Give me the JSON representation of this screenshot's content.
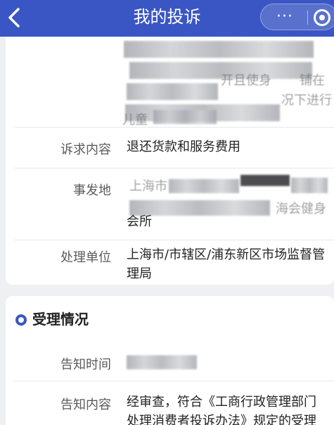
{
  "nav": {
    "title": "我的投诉",
    "more_icon": "···"
  },
  "details": {
    "partial_lines": [
      "开且使身",
      "铺在",
      "况下进行",
      "儿童"
    ],
    "appeal_label": "诉求内容",
    "appeal_value": "退还货款和服务费用",
    "location_label": "事发地",
    "location_value_line1": "上海市",
    "location_value_line2": "海会健身",
    "location_value_line3": "会所",
    "unit_label": "处理单位",
    "unit_value_line1": "上海市/市辖区/浦东新区市场监督管",
    "unit_value_line2": "理局"
  },
  "acceptance": {
    "section_title": "受理情况",
    "notice_time_label": "告知时间",
    "notice_content_label": "告知内容",
    "notice_content_line1": "经审查，符合《工商行政管理部门",
    "notice_content_line2": "处理消费者投诉办法》规定的受理"
  },
  "colors": {
    "primary": "#3a56c4",
    "page_bg": "#eef0f4"
  }
}
